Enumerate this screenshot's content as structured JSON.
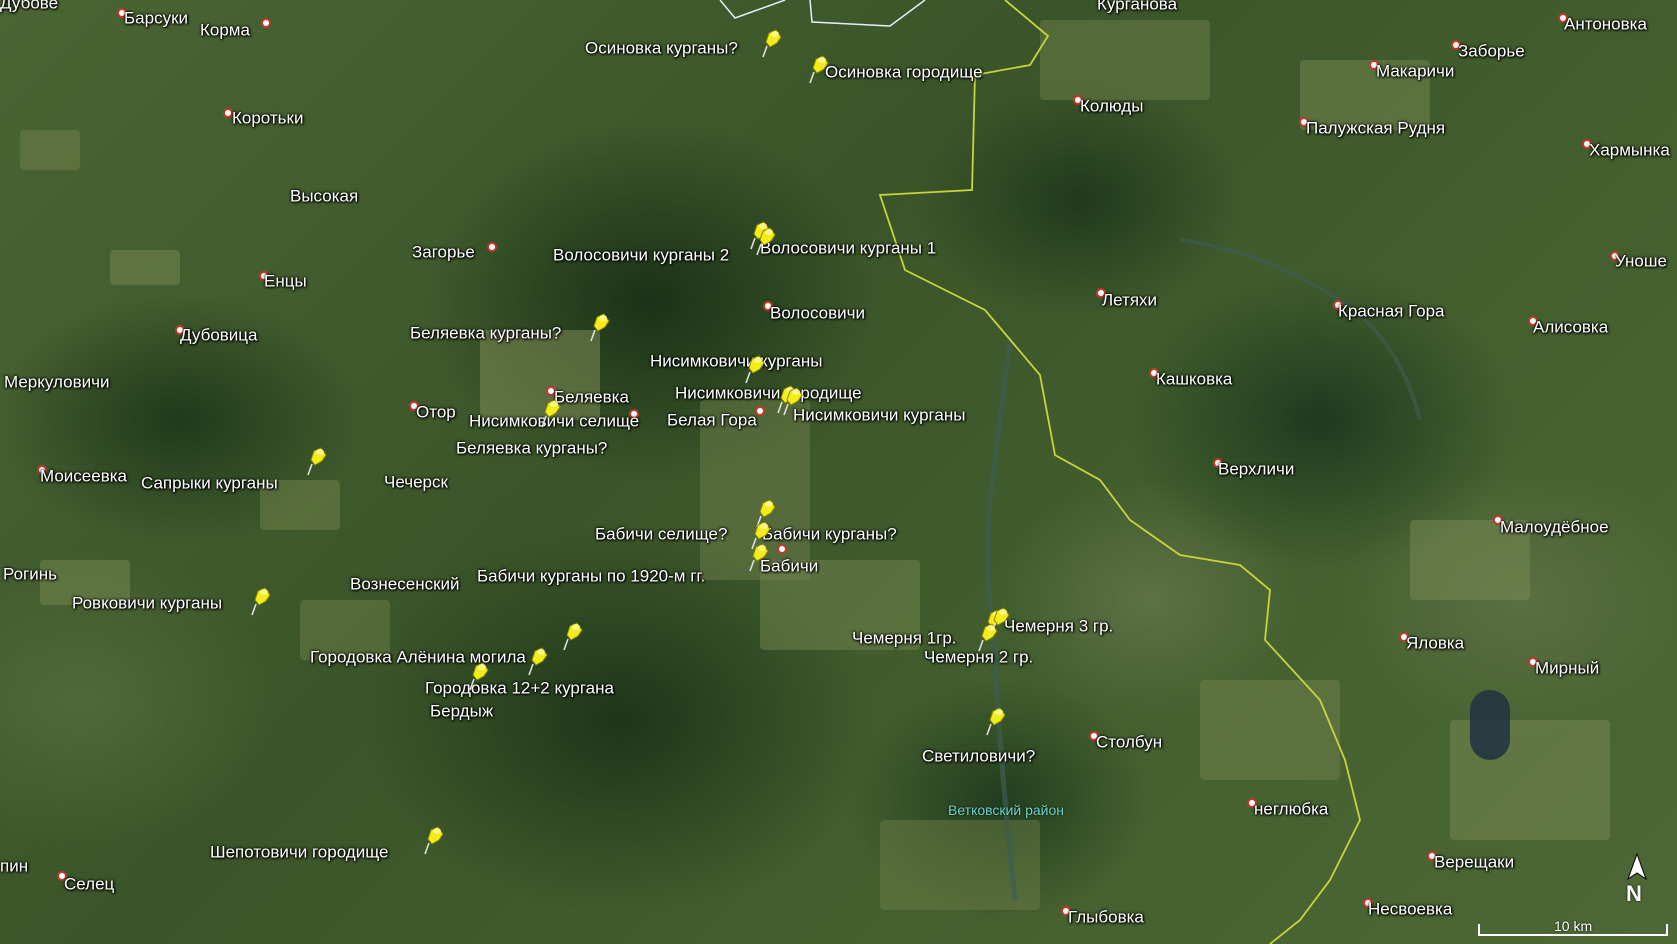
{
  "colors": {
    "border_line": "#c9d33a",
    "district_border": "#e6eef8",
    "pin": "#f2ec1d",
    "settlement_dot": "#c0392b",
    "label": "#ffffff",
    "region_label": "#6fd3c9"
  },
  "settlements": [
    {
      "name": "Дубове"
    },
    {
      "name": "Барсуки"
    },
    {
      "name": "Корма"
    },
    {
      "name": "Коротьки"
    },
    {
      "name": "Высокая"
    },
    {
      "name": "Загорье"
    },
    {
      "name": "Енцы"
    },
    {
      "name": "Дубовица"
    },
    {
      "name": "Меркуловичи"
    },
    {
      "name": "Отор"
    },
    {
      "name": "Беляевка"
    },
    {
      "name": "Белая Гора"
    },
    {
      "name": "Чечерск"
    },
    {
      "name": "Моисеевка"
    },
    {
      "name": "Рогинь"
    },
    {
      "name": "Вознесенский"
    },
    {
      "name": "Бердыж"
    },
    {
      "name": "Волосовичи"
    },
    {
      "name": "Бабичи"
    },
    {
      "name": "Курганова"
    },
    {
      "name": "Колюды"
    },
    {
      "name": "Летяхи"
    },
    {
      "name": "Кашковка"
    },
    {
      "name": "Верхличи"
    },
    {
      "name": "Столбун"
    },
    {
      "name": "Глыбовка"
    },
    {
      "name": "Антоновка"
    },
    {
      "name": "Заборье"
    },
    {
      "name": "Макаричи"
    },
    {
      "name": "Палужская Рудня"
    },
    {
      "name": "Хармынка"
    },
    {
      "name": "Уноше"
    },
    {
      "name": "Красная Гора"
    },
    {
      "name": "Алисовка"
    },
    {
      "name": "Малоудёбное"
    },
    {
      "name": "Яловка"
    },
    {
      "name": "Мирный"
    },
    {
      "name": "неглюбка"
    },
    {
      "name": "Верещаки"
    },
    {
      "name": "Несвоевка"
    },
    {
      "name": "Селец"
    },
    {
      "name": "пин"
    }
  ],
  "placemarks": [
    {
      "name": "Осиновка курганы?"
    },
    {
      "name": "Осиновка городище"
    },
    {
      "name": "Волосовичи курганы 2"
    },
    {
      "name": "Волосовичи курганы 1"
    },
    {
      "name": "Беляевка курганы?"
    },
    {
      "name": "Нисимковичи курганы"
    },
    {
      "name": "Нисимковичи городище"
    },
    {
      "name": "Нисимковичи курганы"
    },
    {
      "name": "Нисимковичи селище"
    },
    {
      "name": "Беляевка курганы?"
    },
    {
      "name": "Сапрыки курганы"
    },
    {
      "name": "Бабичи селище?"
    },
    {
      "name": "Бабичи курганы?"
    },
    {
      "name": "Бабичи курганы по 1920-м гг."
    },
    {
      "name": "Ровковичи курганы"
    },
    {
      "name": "Городовка Алёнина могила"
    },
    {
      "name": "Городовка 12+2 кургана"
    },
    {
      "name": "Чемерня 1гр."
    },
    {
      "name": "Чемерня 3 гр."
    },
    {
      "name": "Чемерня 2 гр."
    },
    {
      "name": "Светиловичи?"
    },
    {
      "name": "Шепотовичи городище"
    }
  ],
  "region_label": "Ветковский район",
  "compass": "N",
  "scale": "10 km"
}
